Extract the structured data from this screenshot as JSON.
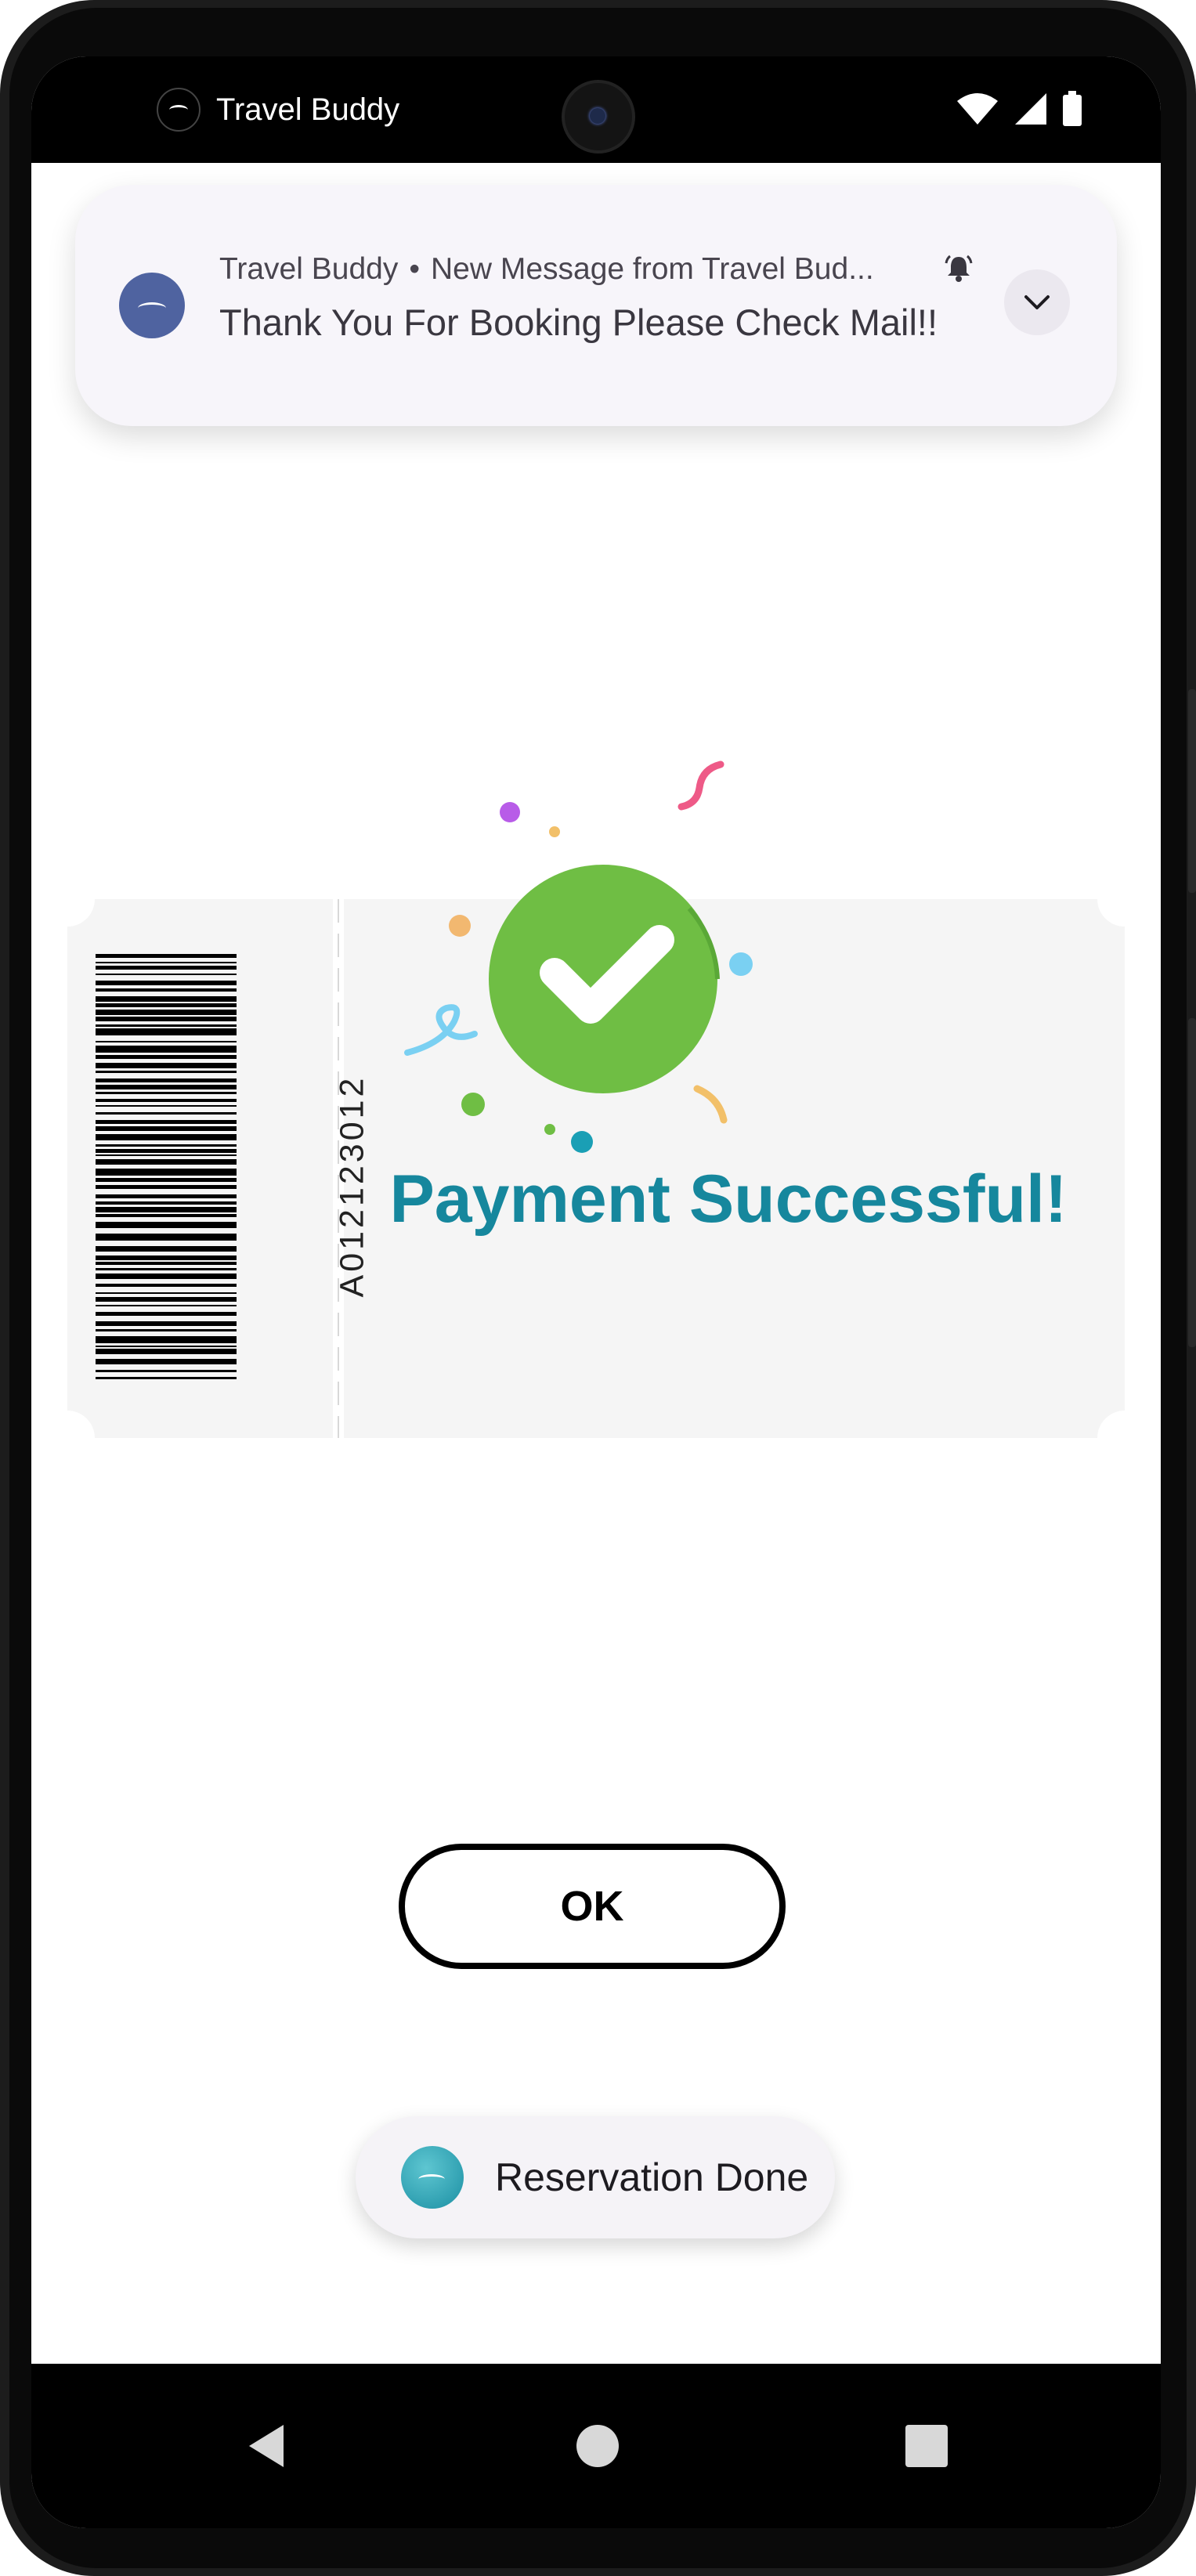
{
  "status_bar": {
    "app_name": "Travel Buddy",
    "icons": [
      "wifi-icon",
      "signal-icon",
      "battery-icon"
    ]
  },
  "notification": {
    "app": "Travel Buddy",
    "separator": "•",
    "title": "New Message from Travel Bud...",
    "message": "Thank You For Booking Please Check Mail!!",
    "icons": [
      "alert-bell-icon",
      "chevron-down-icon"
    ]
  },
  "ticket": {
    "code": "A012123012",
    "status_title": "Payment Successful!"
  },
  "actions": {
    "ok_label": "OK"
  },
  "toast": {
    "text": "Reservation Done"
  },
  "navigation": {
    "icons": [
      "back-icon",
      "home-icon",
      "recents-icon"
    ]
  },
  "colors": {
    "accent": "#16879d",
    "success": "#6fbe44",
    "notification_bg": "#f7f5fa",
    "ticket_bg": "#f5f5f5"
  }
}
